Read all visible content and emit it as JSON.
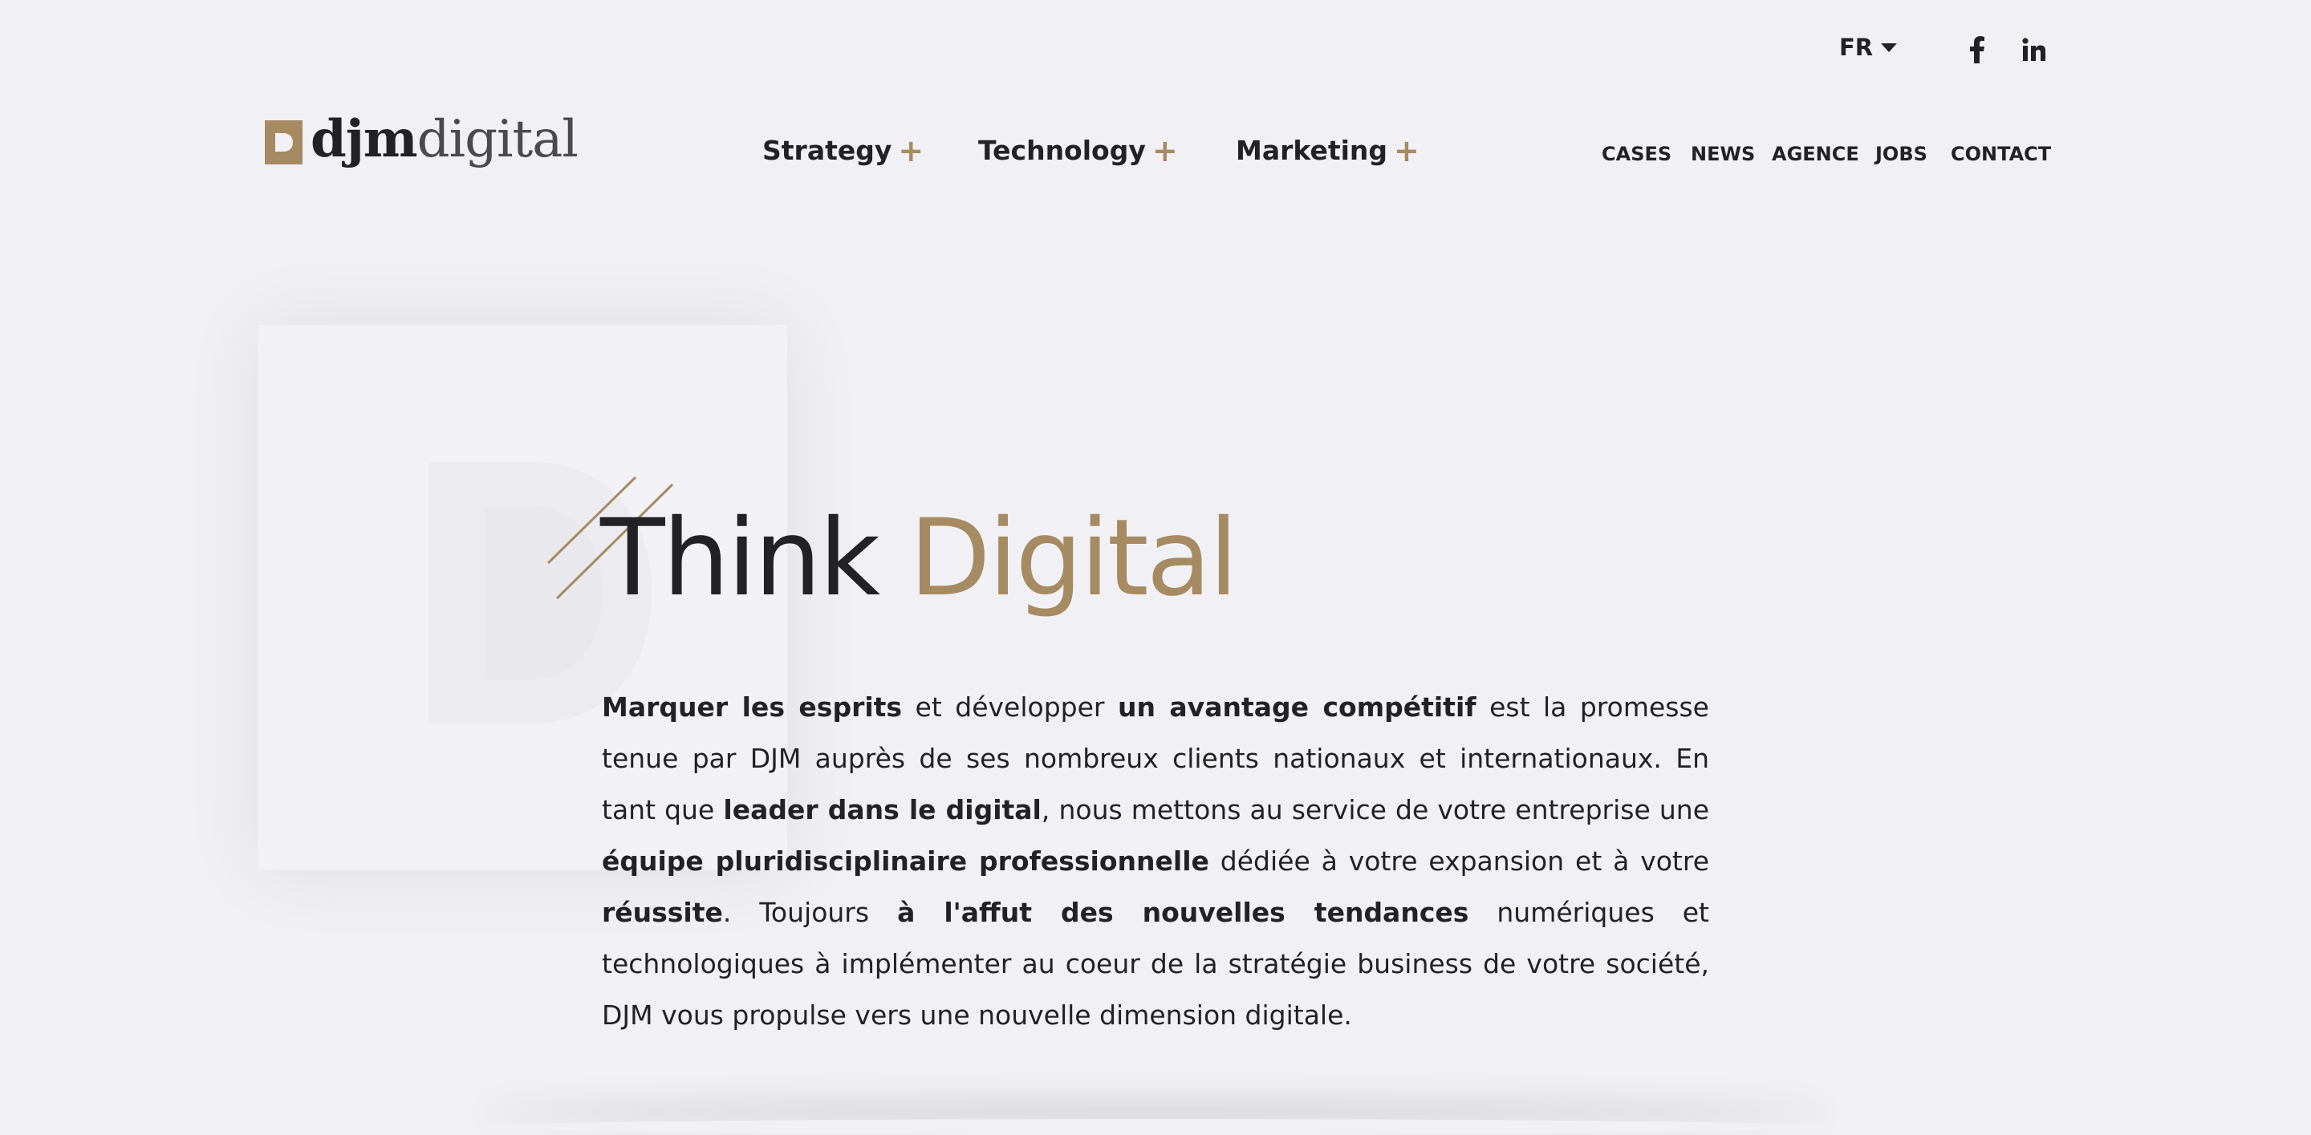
{
  "topbar": {
    "language": "FR",
    "social": [
      {
        "icon": "facebook-icon"
      },
      {
        "icon": "linkedin-icon"
      }
    ]
  },
  "logo": {
    "part1": "djm",
    "part2": "digital"
  },
  "mainnav": {
    "strategy": "Strategy",
    "technology": "Technology",
    "marketing": "Marketing",
    "plus": "+"
  },
  "subnav": {
    "cases": "CASES",
    "news": "NEWS",
    "agence": "AGENCE",
    "jobs": "JOBS",
    "contact": "CONTACT"
  },
  "hero": {
    "title_word1": "Think",
    "title_word2": "Digital",
    "intro": [
      {
        "text": "Marquer les esprits",
        "bold": true
      },
      {
        "text": " et développer ",
        "bold": false
      },
      {
        "text": "un avantage compétitif",
        "bold": true
      },
      {
        "text": " est la promesse tenue par DJM auprès de ses nombreux clients nationaux et internationaux. En tant que ",
        "bold": false
      },
      {
        "text": "leader dans le digital",
        "bold": true
      },
      {
        "text": ", nous mettons au service de votre entreprise une ",
        "bold": false
      },
      {
        "text": "équipe pluridisciplinaire professionnelle",
        "bold": true
      },
      {
        "text": " dédiée à votre expansion et à votre ",
        "bold": false
      },
      {
        "text": "réussite",
        "bold": true
      },
      {
        "text": ". Toujours ",
        "bold": false
      },
      {
        "text": "à l'affut des nouvelles tendances",
        "bold": true
      },
      {
        "text": " numériques et technologiques à implémenter au coeur de la stratégie business de votre société, DJM vous propulse vers une nouvelle dimension digitale.",
        "bold": false
      }
    ]
  },
  "colors": {
    "accent": "#a68a62",
    "text": "#222226",
    "background": "#f1f1f5"
  }
}
